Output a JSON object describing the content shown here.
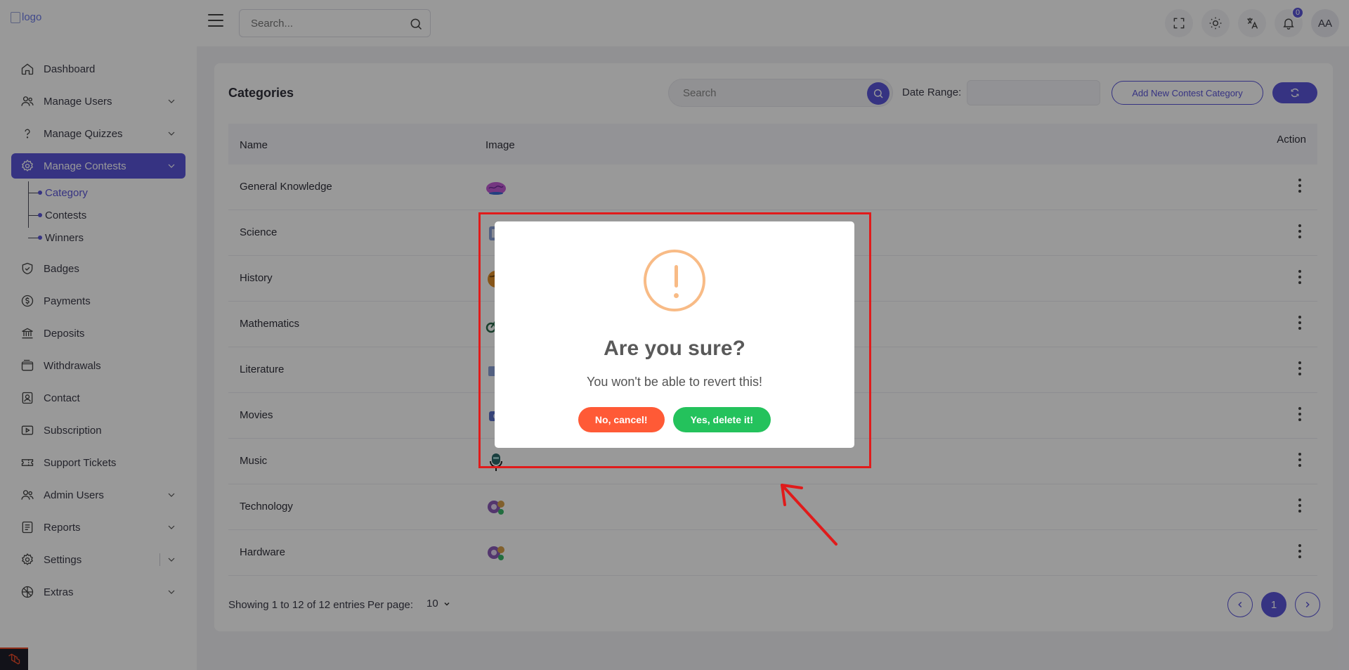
{
  "sidebar": {
    "logo_alt": "logo",
    "items": [
      {
        "label": "Dashboard",
        "icon": "home-icon",
        "chevron": false
      },
      {
        "label": "Manage Users",
        "icon": "users-icon",
        "chevron": true
      },
      {
        "label": "Manage Quizzes",
        "icon": "question-icon",
        "chevron": true
      },
      {
        "label": "Manage Contests",
        "icon": "gear-icon",
        "chevron": true,
        "active": true
      },
      {
        "label": "Badges",
        "icon": "shield-icon",
        "chevron": false
      },
      {
        "label": "Payments",
        "icon": "dollar-icon",
        "chevron": false
      },
      {
        "label": "Deposits",
        "icon": "bank-icon",
        "chevron": false
      },
      {
        "label": "Withdrawals",
        "icon": "wallet-icon",
        "chevron": false
      },
      {
        "label": "Contact",
        "icon": "contact-icon",
        "chevron": false
      },
      {
        "label": "Subscription",
        "icon": "subscription-icon",
        "chevron": false
      },
      {
        "label": "Support Tickets",
        "icon": "ticket-icon",
        "chevron": false
      },
      {
        "label": "Admin Users",
        "icon": "admin-users-icon",
        "chevron": true
      },
      {
        "label": "Reports",
        "icon": "report-icon",
        "chevron": true
      },
      {
        "label": "Settings",
        "icon": "settings-icon",
        "chevron": true
      },
      {
        "label": "Extras",
        "icon": "extras-icon",
        "chevron": true
      }
    ],
    "subitems": [
      {
        "label": "Category",
        "active": true
      },
      {
        "label": "Contests"
      },
      {
        "label": "Winners"
      }
    ]
  },
  "topbar": {
    "search_placeholder": "Search...",
    "notification_count": "0",
    "avatar_initials": "AA"
  },
  "card": {
    "title": "Categories",
    "search_placeholder": "Search",
    "date_range_label": "Date Range:",
    "add_button": "Add New Contest Category",
    "columns": [
      "Name",
      "Image",
      "Action"
    ],
    "rows": [
      {
        "name": "General Knowledge"
      },
      {
        "name": "Science"
      },
      {
        "name": "History"
      },
      {
        "name": "Mathematics"
      },
      {
        "name": "Literature"
      },
      {
        "name": "Movies"
      },
      {
        "name": "Music"
      },
      {
        "name": "Technology"
      },
      {
        "name": "Hardware"
      }
    ],
    "showing": "Showing 1 to 12 of 12 entries",
    "per_page_label": "Per page:",
    "per_page_value": "10",
    "current_page": "1"
  },
  "modal": {
    "title": "Are you sure?",
    "text": "You won't be able to revert this!",
    "cancel_label": "No, cancel!",
    "confirm_label": "Yes, delete it!"
  },
  "colors": {
    "accent": "#5b55d9",
    "cancel": "#ff5a36",
    "confirm": "#24c25c",
    "warning": "#f8bb86",
    "highlight": "#e01b1b"
  }
}
